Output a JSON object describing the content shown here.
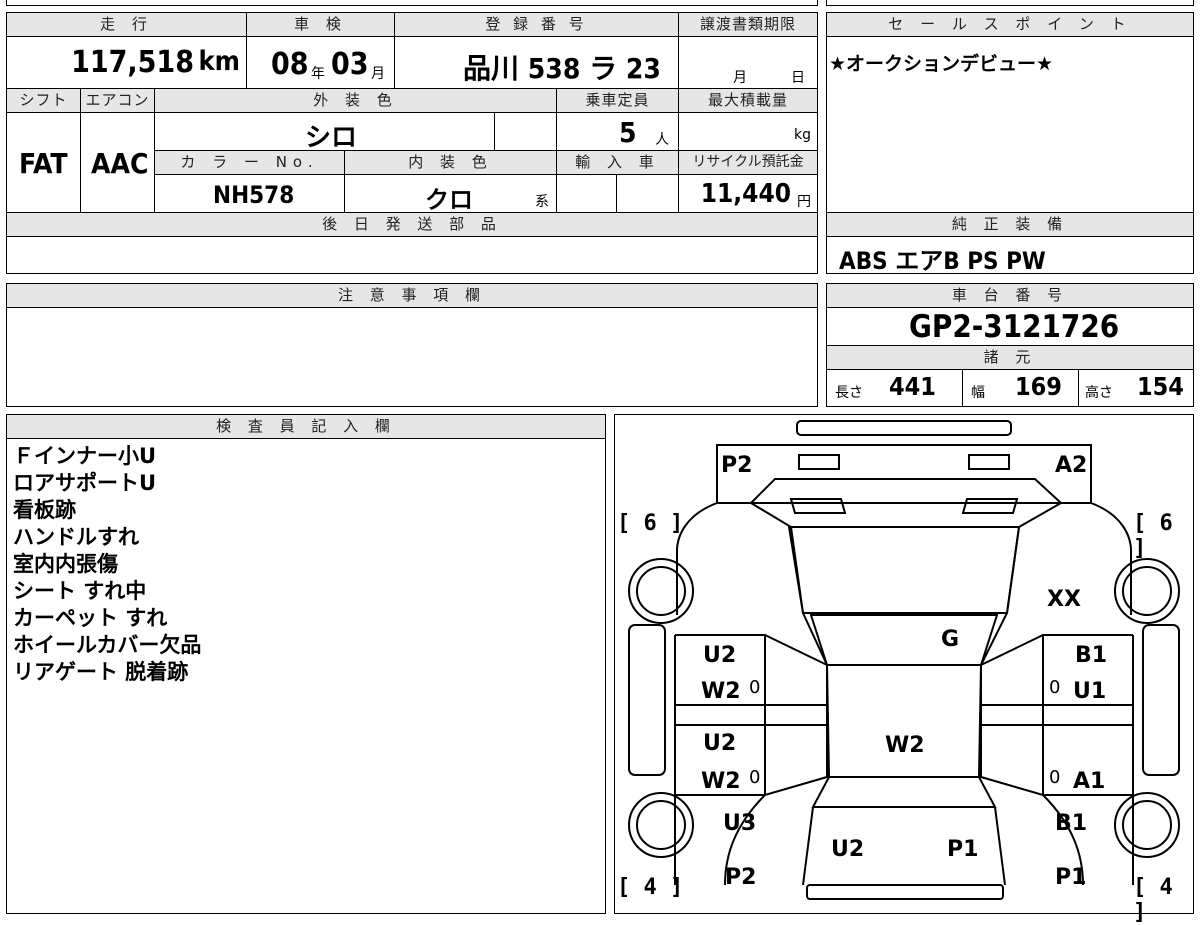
{
  "top_row": {
    "mileage_label": "走 行",
    "mileage_value": "117,518",
    "mileage_unit": "km",
    "inspection_label": "車 検",
    "inspection_year": "08",
    "inspection_year_unit": "年",
    "inspection_month": "03",
    "inspection_month_unit": "月",
    "registration_label": "登 録 番 号",
    "registration_value": "品川 538 ラ 23",
    "transfer_label": "譲渡書類期限",
    "transfer_month_unit": "月",
    "transfer_day_unit": "日"
  },
  "second_row": {
    "shift_label": "シフト",
    "shift_value": "FAT",
    "ac_label": "エアコン",
    "ac_value": "AAC",
    "exterior_label": "外 装 色",
    "exterior_value": "シロ",
    "capacity_label": "乗車定員",
    "capacity_value": "5",
    "capacity_unit": "人",
    "maxload_label": "最大積載量",
    "maxload_unit": "kg",
    "colorno_label": "カ ラ ー No.",
    "colorno_value": "NH578",
    "interior_label": "内 装 色",
    "interior_value": "クロ",
    "interior_suffix": "系",
    "import_label": "輸 入 車",
    "recycle_label": "リサイクル預託金",
    "recycle_value": "11,440",
    "recycle_unit": "円"
  },
  "later_parts": {
    "label": "後 日 発 送 部 品"
  },
  "sales_points": {
    "label": "セ ー ル ス ポ イ ン ト",
    "text": "★オークションデビュー★"
  },
  "equipment": {
    "label": "純 正 装 備",
    "value": "ABS エアB PS PW"
  },
  "notes": {
    "label": "注 意 事 項 欄"
  },
  "chassis": {
    "label": "車 台 番 号",
    "value": "GP2-3121726"
  },
  "specs": {
    "label": "諸 元",
    "length_label": "長さ",
    "length_value": "441",
    "width_label": "幅",
    "width_value": "169",
    "height_label": "高さ",
    "height_value": "154"
  },
  "inspector": {
    "label": "検 査 員 記 入 欄",
    "lines": [
      "Ｆインナー小U",
      "ロアサポートU",
      "看板跡",
      "ハンドルすれ",
      "室内内張傷",
      "シート すれ中",
      "カーペット すれ",
      "ホイールカバー欠品",
      "リアゲート 脱着跡"
    ]
  },
  "diagram": {
    "bracket_tl": "[ 6 ]",
    "bracket_tr": "[ 6 ]",
    "bracket_bl": "[ 4 ]",
    "bracket_br": "[ 4 ]",
    "marks": {
      "p2_top": "P2",
      "a2_top": "A2",
      "xx": "XX",
      "g": "G",
      "u2_fl": "U2",
      "w2_fl": "W2",
      "zero_fl": "0",
      "b1_fr": "B1",
      "zero_fr": "0",
      "u1_fr": "U1",
      "u2_rl": "U2",
      "w2_rl": "W2",
      "zero_rl": "0",
      "w2_roof": "W2",
      "zero_rr": "0",
      "a1_rr": "A1",
      "u3": "U3",
      "b1_rr": "B1",
      "u2_rear": "U2",
      "p1_rear": "P1",
      "p2_bl": "P2",
      "p1_br": "P1"
    }
  }
}
